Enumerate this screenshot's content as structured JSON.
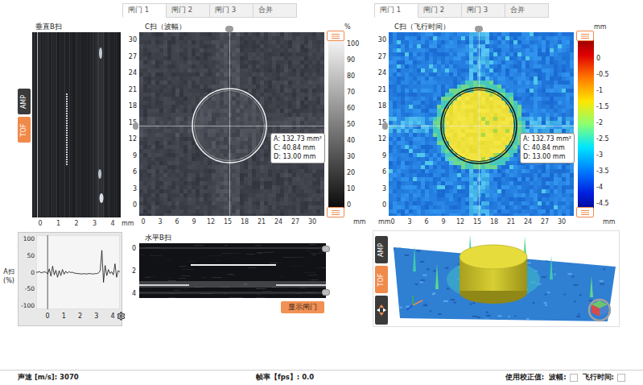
{
  "left_panel": {
    "tabs": [
      {
        "label": "闸门 1",
        "selected": true
      },
      {
        "label": "闸门 2",
        "selected": false
      },
      {
        "label": "闸门 3",
        "selected": false
      },
      {
        "label": "合并",
        "selected": false
      }
    ],
    "view_modes": [
      {
        "label": "AMP",
        "active": false
      },
      {
        "label": "TOF",
        "active": true
      }
    ],
    "vertical_bscan": {
      "title": "垂直B扫",
      "x_ticks": [
        "0",
        "1",
        "2",
        "3",
        "4"
      ],
      "x_unit": "mm"
    },
    "cscan": {
      "kind": "amplitude",
      "title": "C扫（波幅）",
      "colorbar_unit": "%",
      "colorbar_ticks": [
        "100",
        "90",
        "80",
        "70",
        "60",
        "50",
        "40",
        "30",
        "20",
        "10",
        "0"
      ],
      "y_ticks": [
        "30",
        "27",
        "24",
        "21",
        "18",
        "15",
        "12",
        "9",
        "6",
        "3",
        "0"
      ],
      "x_ticks": [
        "0",
        "3",
        "6",
        "9",
        "12",
        "15",
        "18",
        "21",
        "24",
        "27",
        "30"
      ],
      "x_unit_right": "mm",
      "measurement": [
        "A: 132.73 mm²",
        "C: 40.84 mm",
        "D: 13.00 mm"
      ]
    },
    "ascan": {
      "title": "A扫",
      "unit": "(%)",
      "y_ticks": [
        "100",
        "50",
        "0",
        "-50",
        "-100"
      ],
      "x_ticks": [
        "0",
        "1",
        "2",
        "3",
        "4"
      ],
      "values": [
        0,
        0,
        2,
        -2,
        0,
        1,
        0,
        -5,
        10,
        -12,
        18,
        -8,
        6,
        -15,
        5,
        -10,
        8,
        -6,
        3,
        -3,
        2,
        -1,
        0,
        -2,
        -3,
        -4,
        -4,
        -5,
        -5,
        -4,
        -5,
        -5,
        -4,
        -4,
        -5,
        -5,
        -4,
        -4,
        -2,
        5,
        65,
        -30,
        20,
        -10,
        8,
        -4,
        2,
        -8,
        25,
        -15,
        5,
        0
      ]
    },
    "horizontal_bscan": {
      "title": "水平B扫",
      "y_ticks": [
        "0",
        "2",
        "4"
      ],
      "button": "显示闸门"
    }
  },
  "right_panel": {
    "tabs": [
      {
        "label": "闸门 1",
        "selected": true
      },
      {
        "label": "闸门 2",
        "selected": false
      },
      {
        "label": "闸门 3",
        "selected": false
      },
      {
        "label": "合并",
        "selected": false
      }
    ],
    "cscan": {
      "kind": "time_of_flight",
      "title": "C扫（飞行时间）",
      "colorbar_unit": "mm",
      "colorbar_ticks": [
        "0",
        "-0.5",
        "-1",
        "-1.5",
        "-2",
        "-2.5",
        "-3",
        "-3.5",
        "-4",
        "-4.5"
      ],
      "y_ticks": [
        "30",
        "27",
        "24",
        "21",
        "18",
        "15",
        "12",
        "9",
        "6",
        "3",
        "0"
      ],
      "x_ticks": [
        "0",
        "3",
        "6",
        "9",
        "12",
        "15",
        "18",
        "21",
        "24",
        "27",
        "30"
      ],
      "x_unit_left": "mm",
      "x_unit_right": "mm",
      "measurement": [
        "A: 132.73 mm²",
        "C: 40.84 mm",
        "D: 13.00 mm"
      ]
    },
    "view_3d": {
      "view_modes": [
        {
          "label": "AMP",
          "active": false
        },
        {
          "label": "TOF",
          "active": true
        }
      ]
    }
  },
  "status_bar": {
    "sound_speed": "声速 [m/s]: 3070",
    "frame_rate": "帧率【fps】: 0.0",
    "calibration_label": "使用校正值:",
    "checkboxes": [
      {
        "label": "波幅:",
        "checked": false
      },
      {
        "label": "飞行时间:",
        "checked": false
      }
    ]
  }
}
